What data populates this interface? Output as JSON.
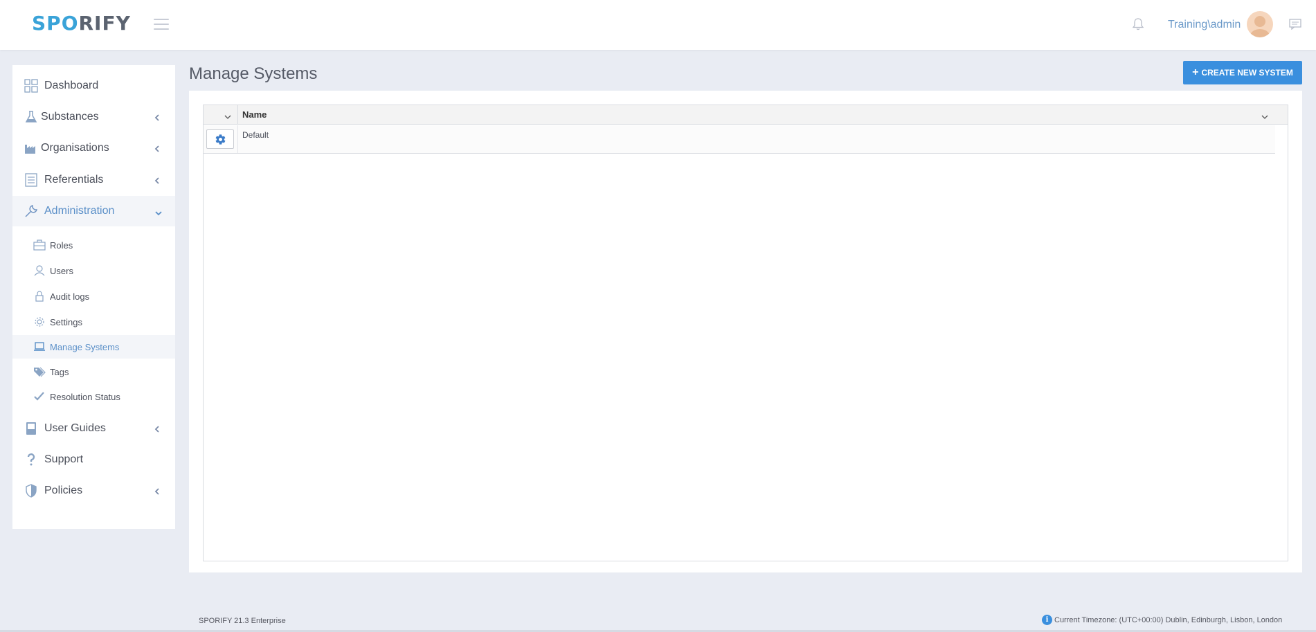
{
  "header": {
    "logo_part1": "SP",
    "logo_part2": "O",
    "logo_part3": "RIFY",
    "user_name": "Training\\admin",
    "icons": [
      "hamburger-icon",
      "bell-icon",
      "chat-icon"
    ]
  },
  "sidebar": {
    "items": [
      {
        "label": "Dashboard",
        "icon": "dashboard-icon"
      },
      {
        "label": "Substances",
        "icon": "flask-icon"
      },
      {
        "label": "Organisations",
        "icon": "factory-icon"
      },
      {
        "label": "Referentials",
        "icon": "list-icon"
      },
      {
        "label": "Administration",
        "icon": "wrench-icon"
      },
      {
        "label": "User Guides",
        "icon": "book-icon"
      },
      {
        "label": "Support",
        "icon": "question-icon"
      },
      {
        "label": "Policies",
        "icon": "shield-icon"
      }
    ],
    "admin_sub": [
      {
        "label": "Roles",
        "icon": "briefcase-icon"
      },
      {
        "label": "Users",
        "icon": "users-icon"
      },
      {
        "label": "Audit logs",
        "icon": "lock-icon"
      },
      {
        "label": "Settings",
        "icon": "gear-icon"
      },
      {
        "label": "Manage Systems",
        "icon": "laptop-icon"
      },
      {
        "label": "Tags",
        "icon": "tags-icon"
      },
      {
        "label": "Resolution Status",
        "icon": "check-icon"
      }
    ]
  },
  "main": {
    "title": "Manage Systems",
    "create_button": "CREATE NEW SYSTEM",
    "grid": {
      "columns": [
        "Name"
      ],
      "rows": [
        {
          "name": "Default"
        }
      ]
    }
  },
  "footer": {
    "version": "SPORIFY 21.3 Enterprise",
    "timezone": "Current Timezone: (UTC+00:00) Dublin, Edinburgh, Lisbon, London"
  },
  "colors": {
    "accent": "#3a8fde",
    "active_text": "#5a8fc8",
    "logo_blue": "#3aa3d8",
    "logo_gray": "#5b6370",
    "background": "#e9ecf3"
  }
}
